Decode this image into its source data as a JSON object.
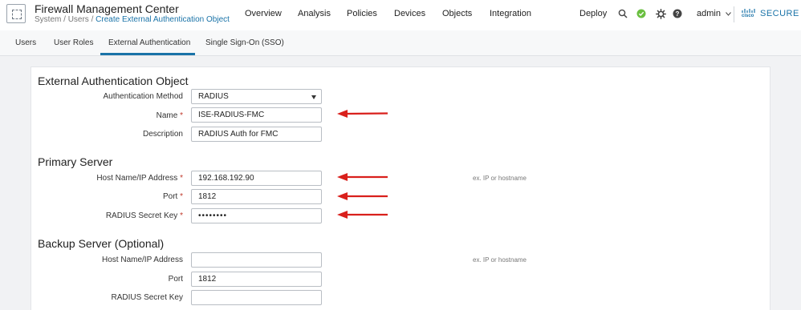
{
  "app": {
    "title": "Firewall Management Center",
    "breadcrumb": {
      "part1": "System",
      "sep1": " / ",
      "part2": "Users",
      "sep2": " / ",
      "current": "Create External Authentication Object"
    }
  },
  "nav": {
    "overview": "Overview",
    "analysis": "Analysis",
    "policies": "Policies",
    "devices": "Devices",
    "objects": "Objects",
    "integration": "Integration"
  },
  "toolbar": {
    "deploy": "Deploy",
    "user": "admin",
    "brand_small": "cisco",
    "brand": "SECURE"
  },
  "tabs": {
    "users": "Users",
    "user_roles": "User Roles",
    "external_auth": "External Authentication",
    "sso": "Single Sign-On (SSO)"
  },
  "form": {
    "section_main": "External Authentication Object",
    "auth_method_label": "Authentication Method",
    "auth_method_value": "RADIUS",
    "name_label": "Name",
    "name_value": "ISE-RADIUS-FMC",
    "description_label": "Description",
    "description_value": "RADIUS Auth for FMC",
    "required_mark": "*",
    "primary": {
      "title": "Primary Server",
      "host_label": "Host Name/IP Address",
      "host_value": "192.168.192.90",
      "host_hint": "ex. IP or hostname",
      "port_label": "Port",
      "port_value": "1812",
      "secret_label": "RADIUS Secret Key",
      "secret_value": "••••••••"
    },
    "backup": {
      "title": "Backup Server (Optional)",
      "host_label": "Host Name/IP Address",
      "host_value": "",
      "host_hint": "ex. IP or hostname",
      "port_label": "Port",
      "port_value": "1812",
      "secret_label": "RADIUS Secret Key",
      "secret_value": ""
    }
  },
  "colors": {
    "accent": "#1a73a8",
    "arrow": "#d9201c",
    "status_ok": "#6abf40",
    "required": "#c0392b"
  },
  "icons": [
    "fmc-logo-icon",
    "search-icon",
    "status-ok-icon",
    "gear-icon",
    "help-icon",
    "chevron-down-icon",
    "cisco-logo-icon",
    "arrow-annotation-icon"
  ]
}
